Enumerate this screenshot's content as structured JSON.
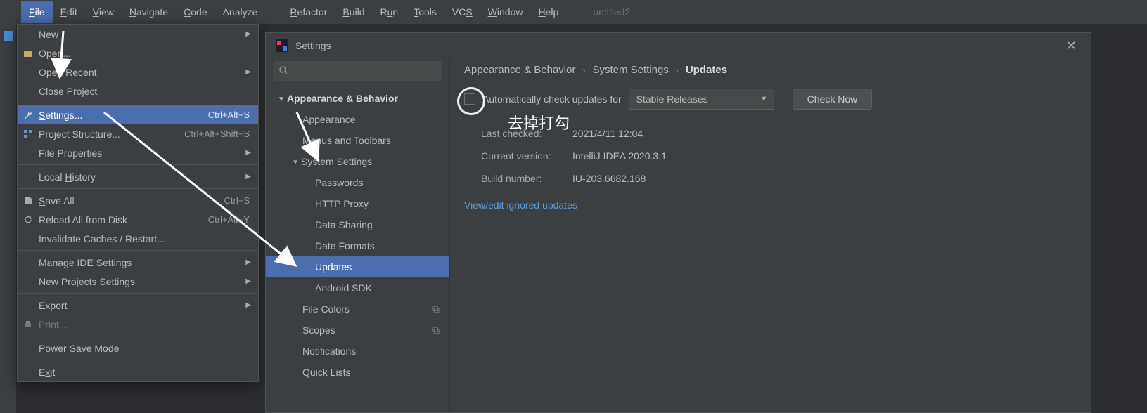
{
  "menubar": {
    "items": [
      {
        "label": "File",
        "u": "F",
        "sel": true
      },
      {
        "label": "Edit",
        "u": "E"
      },
      {
        "label": "View",
        "u": "V"
      },
      {
        "label": "Navigate",
        "u": "N"
      },
      {
        "label": "Code",
        "u": "C"
      },
      {
        "label": "Analyze"
      },
      {
        "label": "Refactor",
        "u": "R"
      },
      {
        "label": "Build",
        "u": "B"
      },
      {
        "label": "Run",
        "u": "u",
        "upos": 1
      },
      {
        "label": "Tools",
        "u": "T"
      },
      {
        "label": "VCS",
        "u": "S",
        "upos": 2
      },
      {
        "label": "Window",
        "u": "W"
      },
      {
        "label": "Help",
        "u": "H"
      }
    ],
    "project": "untitled2"
  },
  "filemenu": {
    "items": [
      {
        "label": "New",
        "u": "N",
        "sub": true
      },
      {
        "label": "Open...",
        "u": "O",
        "icon": "folder"
      },
      {
        "label": "Open Recent",
        "u": "R",
        "upos": 5,
        "sub": true
      },
      {
        "label": "Close Project",
        "u": "j",
        "upos": 10
      },
      {
        "type": "sep"
      },
      {
        "label": "Settings...",
        "u": "S",
        "shortcut": "Ctrl+Alt+S",
        "icon": "wrench",
        "sel": true
      },
      {
        "label": "Project Structure...",
        "u": "",
        "shortcut": "Ctrl+Alt+Shift+S",
        "icon": "structure"
      },
      {
        "label": "File Properties",
        "sub": true
      },
      {
        "type": "sep"
      },
      {
        "label": "Local History",
        "u": "H",
        "upos": 6,
        "sub": true
      },
      {
        "type": "sep"
      },
      {
        "label": "Save All",
        "u": "S",
        "shortcut": "Ctrl+S",
        "icon": "save"
      },
      {
        "label": "Reload All from Disk",
        "u": "",
        "shortcut": "Ctrl+Alt+Y",
        "icon": "reload"
      },
      {
        "label": "Invalidate Caches / Restart..."
      },
      {
        "type": "sep"
      },
      {
        "label": "Manage IDE Settings",
        "sub": true
      },
      {
        "label": "New Projects Settings",
        "sub": true
      },
      {
        "type": "sep"
      },
      {
        "label": "Export",
        "sub": true
      },
      {
        "label": "Print...",
        "u": "P",
        "icon": "print",
        "dim": true
      },
      {
        "type": "sep"
      },
      {
        "label": "Power Save Mode"
      },
      {
        "type": "sep"
      },
      {
        "label": "Exit",
        "u": "x",
        "upos": 1
      }
    ]
  },
  "dialog": {
    "title": "Settings",
    "search_placeholder": "",
    "tree": [
      {
        "label": "Appearance & Behavior",
        "level": 0,
        "expanded": true
      },
      {
        "label": "Appearance",
        "level": 1
      },
      {
        "label": "Menus and Toolbars",
        "level": 1
      },
      {
        "label": "System Settings",
        "level": "1b",
        "expanded": true
      },
      {
        "label": "Passwords",
        "level": 2
      },
      {
        "label": "HTTP Proxy",
        "level": 2
      },
      {
        "label": "Data Sharing",
        "level": 2
      },
      {
        "label": "Date Formats",
        "level": 2
      },
      {
        "label": "Updates",
        "level": 2,
        "sel": true
      },
      {
        "label": "Android SDK",
        "level": 2
      },
      {
        "label": "File Colors",
        "level": 1,
        "badge": "⧉"
      },
      {
        "label": "Scopes",
        "level": 1,
        "badge": "⧉"
      },
      {
        "label": "Notifications",
        "level": 1
      },
      {
        "label": "Quick Lists",
        "level": 1
      }
    ],
    "breadcrumbs": [
      "Appearance & Behavior",
      "System Settings",
      "Updates"
    ],
    "checkbox_label": "Automatically check updates for",
    "select_value": "Stable Releases",
    "check_now": "Check Now",
    "info": {
      "last_checked_k": "Last checked:",
      "last_checked_v": "2021/4/11 12:04",
      "current_version_k": "Current version:",
      "current_version_v": "IntelliJ IDEA 2020.3.1",
      "build_k": "Build number:",
      "build_v": "IU-203.6682.168"
    },
    "link": "View/edit ignored updates"
  },
  "annotation": "去掉打勾"
}
